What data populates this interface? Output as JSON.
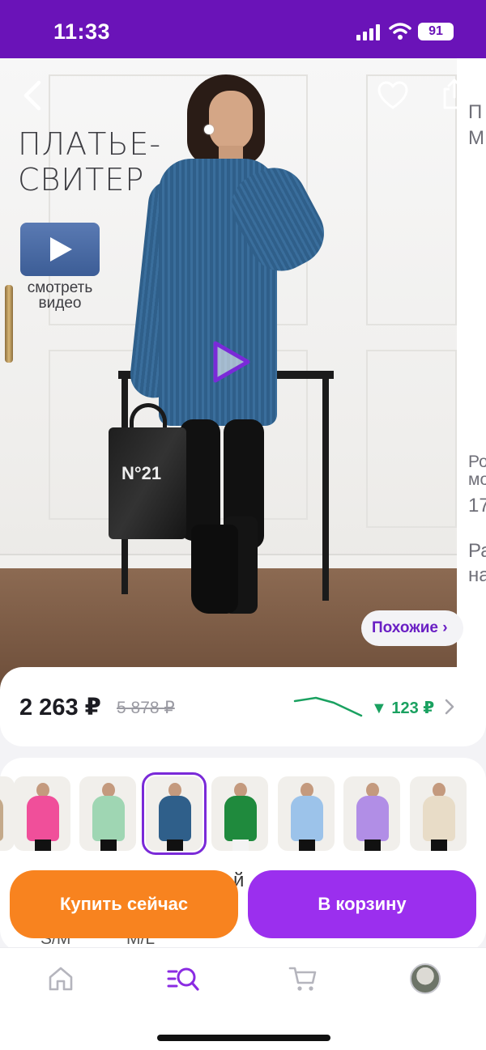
{
  "status_bar": {
    "time": "11:33",
    "battery": "91"
  },
  "product": {
    "title_line1": "ПЛАТЬЕ-",
    "title_line2": "СВИТЕР",
    "video_caption": "смотреть видео",
    "bag_print": "N°21"
  },
  "side_preview": {
    "lines": [
      "П",
      "М",
      "Ро",
      "мо",
      "17",
      "Ра",
      "на"
    ]
  },
  "similar_label": "Похожие ›",
  "price": {
    "current": "2 263 ₽",
    "old": "5 878 ₽",
    "drop": "▼ 123 ₽",
    "drop_color": "#1aa160"
  },
  "variants": [
    {
      "color": "#f04f9a"
    },
    {
      "color": "#9fd6b3"
    },
    {
      "color": "#2f5f8a",
      "selected": true
    },
    {
      "color": "#1f8a3d"
    },
    {
      "color": "#9cc3ea"
    },
    {
      "color": "#b18ee6"
    },
    {
      "color": "#e8dcc7"
    }
  ],
  "sizes": {
    "partial_label": "й",
    "s_m": "S/M",
    "m_l": "M/L"
  },
  "actions": {
    "buy_now": "Купить сейчас",
    "add_to_cart": "В корзину"
  },
  "colors": {
    "brand": "#6a13b8",
    "buy_now": "#f8831f",
    "add_cart": "#9b2fee"
  },
  "nav": {
    "items": [
      "home-icon",
      "catalog-search-icon",
      "cart-icon",
      "profile-avatar"
    ]
  }
}
